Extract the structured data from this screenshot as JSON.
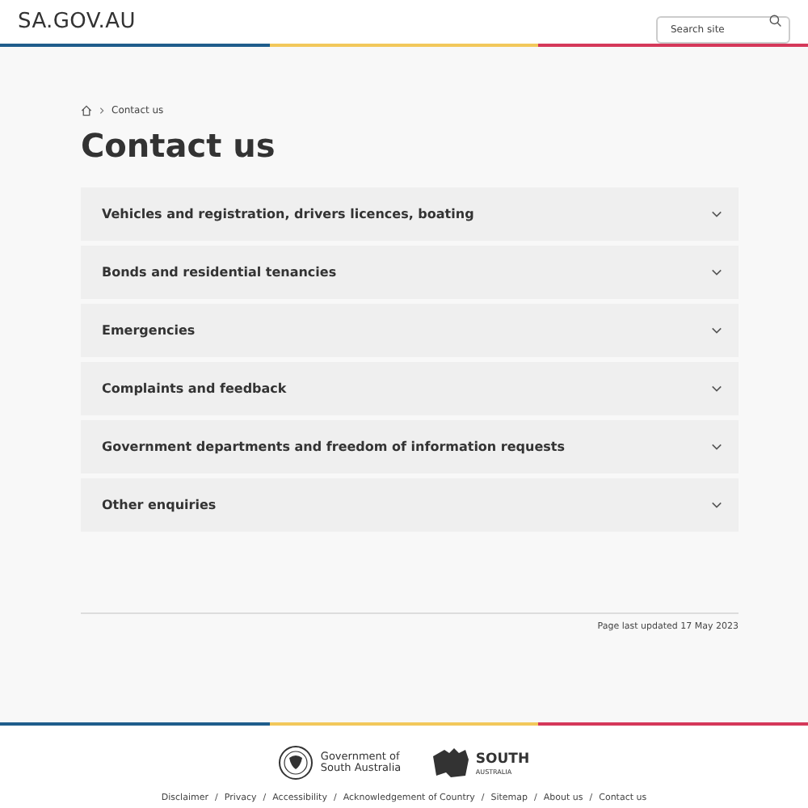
{
  "header": {
    "logo": "SA.GOV.AU",
    "search": {
      "placeholder": "Search site"
    }
  },
  "breadcrumb": [
    {
      "label": "Contact us"
    }
  ],
  "title": "Contact us",
  "accordion": [
    {
      "label": "Vehicles and registration, drivers licences, boating",
      "expanded": false
    },
    {
      "label": "Bonds and residential tenancies",
      "expanded": false
    },
    {
      "label": "Emergencies",
      "expanded": false
    },
    {
      "label": "Complaints and feedback",
      "expanded": false
    },
    {
      "label": "Government departments and freedom of information requests",
      "expanded": false
    },
    {
      "label": "Other enquiries",
      "expanded": false
    }
  ],
  "last_updated": "Page last updated 17 May 2023",
  "footer": {
    "gov_logo": "Government of South Australia",
    "brand_logo": "SOUTH",
    "brand_sub": "AUSTRALIA",
    "separator": "/",
    "links": [
      "Disclaimer",
      "Privacy",
      "Accessibility",
      "Acknowledgement of Country",
      "Sitemap",
      "About us",
      "Contact us"
    ]
  }
}
